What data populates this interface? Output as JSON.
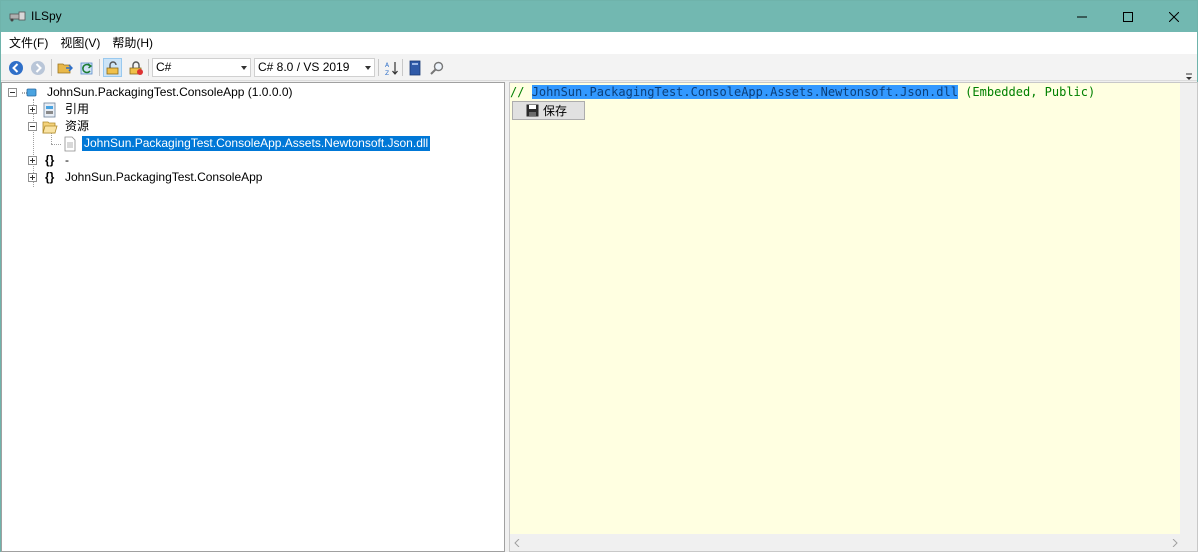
{
  "window": {
    "title": "ILSpy",
    "accent_color": "#72b8b1"
  },
  "menu": {
    "items": [
      {
        "label": "文件(F)"
      },
      {
        "label": "视图(V)"
      },
      {
        "label": "帮助(H)"
      }
    ]
  },
  "toolbar": {
    "back_icon": "back-arrow-icon",
    "forward_icon": "forward-arrow-icon",
    "open_icon": "open-folder-icon",
    "reload_icon": "reload-icon",
    "show_public_icon": "public-filter-icon",
    "show_all_icon": "all-members-icon",
    "language": "C#",
    "language_version": "C# 8.0 / VS 2019",
    "sort_icon": "sort-az-icon",
    "book_icon": "book-icon",
    "search_icon": "search-icon"
  },
  "tree": {
    "root": {
      "label": "JohnSun.PackagingTest.ConsoleApp (1.0.0.0)"
    },
    "references": {
      "label": "引用"
    },
    "resources": {
      "label": "资源"
    },
    "resource_file": {
      "label": "JohnSun.PackagingTest.ConsoleApp.Assets.Newtonsoft.Json.dll"
    },
    "namespace_empty": {
      "label": "-"
    },
    "namespace_main": {
      "label": "JohnSun.PackagingTest.ConsoleApp"
    },
    "namespace_glyph": "{}",
    "selection_color": "#0078d7"
  },
  "code": {
    "comment_prefix": "// ",
    "resource_name": "JohnSun.PackagingTest.ConsoleApp.Assets.Newtonsoft.Json.dll",
    "resource_suffix": " (Embedded, Public)",
    "save_label": "保存",
    "background_color": "#ffffe1"
  }
}
